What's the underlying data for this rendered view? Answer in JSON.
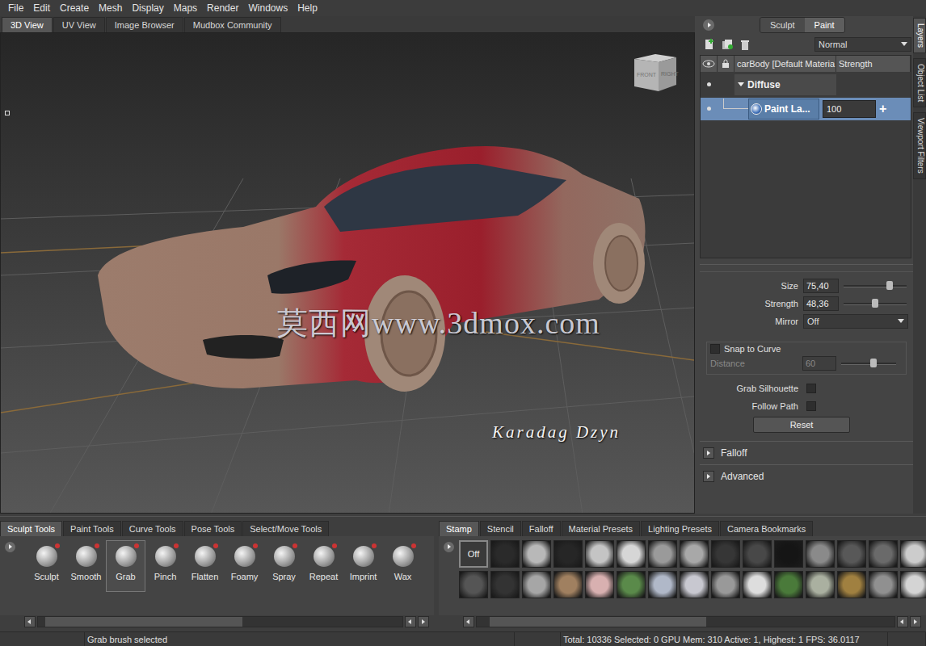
{
  "menu": [
    "File",
    "Edit",
    "Create",
    "Mesh",
    "Display",
    "Maps",
    "Render",
    "Windows",
    "Help"
  ],
  "view_tabs": [
    {
      "label": "3D View",
      "selected": true
    },
    {
      "label": "UV View",
      "selected": false
    },
    {
      "label": "Image Browser",
      "selected": false
    },
    {
      "label": "Mudbox Community",
      "selected": false
    }
  ],
  "viewport": {
    "view_cube": [
      "FRONT",
      "RIGHT"
    ],
    "watermark": "莫西网www.3dmox.com",
    "signature": "Karadag Dzyn"
  },
  "side_tabs": [
    {
      "label": "Layers",
      "selected": true
    },
    {
      "label": "Object List",
      "selected": false
    },
    {
      "label": "Viewport Filters",
      "selected": false
    }
  ],
  "mode_toggle": [
    {
      "label": "Sculpt",
      "selected": false
    },
    {
      "label": "Paint",
      "selected": true
    }
  ],
  "blend_mode": "Normal",
  "layers": {
    "columns": [
      "carBody [Default Materia",
      "Strength"
    ],
    "rows": [
      {
        "kind": "channel",
        "name": "Diffuse",
        "expanded": true,
        "selected": false
      },
      {
        "kind": "layer",
        "name": "Paint La...",
        "strength": "100",
        "selected": true
      }
    ],
    "add": "+"
  },
  "properties": {
    "sliders": [
      {
        "label": "Size",
        "value": "75,40",
        "level": 0.73
      },
      {
        "label": "Strength",
        "value": "48,36",
        "level": 0.5
      }
    ],
    "mirror": {
      "label": "Mirror",
      "value": "Off"
    },
    "snap": {
      "label": "Snap to Curve",
      "checked": false
    },
    "distance": {
      "label": "Distance",
      "value": "60",
      "level": 0.59,
      "disabled": true
    },
    "checks": [
      {
        "label": "Grab Silhouette",
        "checked": false
      },
      {
        "label": "Follow Path",
        "checked": false
      }
    ],
    "reset": "Reset",
    "sections": [
      {
        "label": "Falloff",
        "expanded": false
      },
      {
        "label": "Advanced",
        "expanded": false
      }
    ]
  },
  "tool_tabs": [
    {
      "label": "Sculpt Tools",
      "selected": true
    },
    {
      "label": "Paint Tools",
      "selected": false
    },
    {
      "label": "Curve Tools",
      "selected": false
    },
    {
      "label": "Pose Tools",
      "selected": false
    },
    {
      "label": "Select/Move Tools",
      "selected": false
    }
  ],
  "tools": [
    {
      "label": "Sculpt",
      "selected": false
    },
    {
      "label": "Smooth",
      "selected": false
    },
    {
      "label": "Grab",
      "selected": true
    },
    {
      "label": "Pinch",
      "selected": false
    },
    {
      "label": "Flatten",
      "selected": false
    },
    {
      "label": "Foamy",
      "selected": false
    },
    {
      "label": "Spray",
      "selected": false
    },
    {
      "label": "Repeat",
      "selected": false
    },
    {
      "label": "Imprint",
      "selected": false
    },
    {
      "label": "Wax",
      "selected": false
    }
  ],
  "tray_tabs": [
    {
      "label": "Stamp",
      "selected": true
    },
    {
      "label": "Stencil",
      "selected": false
    },
    {
      "label": "Falloff",
      "selected": false
    },
    {
      "label": "Material Presets",
      "selected": false
    },
    {
      "label": "Lighting Presets",
      "selected": false
    },
    {
      "label": "Camera Bookmarks",
      "selected": false
    }
  ],
  "stamp_off": {
    "label": "Off",
    "selected": true
  },
  "stamps": [
    {
      "color": "#2a2a2a",
      "selected": false
    },
    {
      "color": "#b8b8b8",
      "selected": false
    },
    {
      "color": "#262626",
      "selected": false
    },
    {
      "color": "#c4c4c4",
      "selected": false
    },
    {
      "color": "#d6d6d6",
      "selected": false
    },
    {
      "color": "#9a9a9a",
      "selected": false
    },
    {
      "color": "#a8a8a8",
      "selected": false
    },
    {
      "color": "#363636",
      "selected": false
    },
    {
      "color": "#484848",
      "selected": false
    },
    {
      "color": "#151515",
      "selected": false
    },
    {
      "color": "#8a8a8a",
      "selected": false
    },
    {
      "color": "#585858",
      "selected": false
    },
    {
      "color": "#6a6a6a",
      "selected": false
    },
    {
      "color": "#cccccc",
      "selected": false
    },
    {
      "color": "#555555",
      "selected": false
    },
    {
      "color": "#333333",
      "selected": false
    },
    {
      "color": "#a6a6a6",
      "selected": false
    },
    {
      "color": "#a08060",
      "selected": false
    },
    {
      "color": "#d8b0b0",
      "selected": false
    },
    {
      "color": "#5a8a4a",
      "selected": false
    },
    {
      "color": "#b0b8c8",
      "selected": false
    },
    {
      "color": "#c8c8d0",
      "selected": false
    },
    {
      "color": "#999999",
      "selected": false
    },
    {
      "color": "#dddddd",
      "selected": false
    },
    {
      "color": "#4a7a3a",
      "selected": false
    },
    {
      "color": "#aab0a0",
      "selected": false
    },
    {
      "color": "#a08040",
      "selected": false
    },
    {
      "color": "#909090",
      "selected": false
    },
    {
      "color": "#d4d4d4",
      "selected": false
    }
  ],
  "status": {
    "message": "Grab brush selected",
    "stats": "Total: 10336  Selected: 0 GPU Mem: 310  Active: 1, Highest: 1  FPS: 36.0117"
  }
}
